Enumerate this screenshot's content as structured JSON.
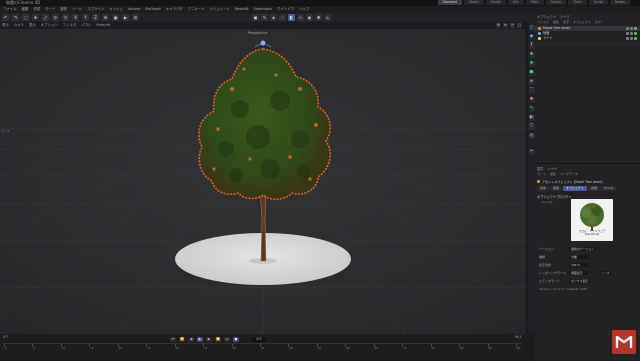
{
  "window": {
    "title": "無題のCinema 4D"
  },
  "layout_tabs": [
    {
      "label": "Standard",
      "active": true
    },
    {
      "label": "Model",
      "active": false
    },
    {
      "label": "Sculpt",
      "active": false
    },
    {
      "label": "UVs",
      "active": false
    },
    {
      "label": "Paint",
      "active": false
    },
    {
      "label": "Groom",
      "active": false
    },
    {
      "label": "Track",
      "active": false
    },
    {
      "label": "Script",
      "active": false
    },
    {
      "label": "Nodes",
      "active": false
    }
  ],
  "menu": [
    "ファイル",
    "編集",
    "作成",
    "モード",
    "選択",
    "ツール",
    "スプライン",
    "メッシュ",
    "Volume",
    "MoGraph",
    "キャラクタ",
    "アニメート",
    "シミュレート",
    "Redshift",
    "Extensions",
    "ウインドウ",
    "ヘルプ"
  ],
  "toolbar": {
    "left_icons": [
      "undo-icon",
      "redo-icon",
      "live-select-icon",
      "move-icon",
      "scale-icon",
      "rotate-icon",
      "recent-icon",
      "x-axis-icon",
      "y-axis-icon",
      "z-axis-icon",
      "coord-icon",
      "render-view-icon",
      "render-icon",
      "render-settings-icon"
    ],
    "center_icons": [
      {
        "name": "cube-icon",
        "active": false
      },
      {
        "name": "pen-icon",
        "active": false
      },
      {
        "name": "subdivide-icon",
        "active": false
      },
      {
        "name": "array-icon",
        "active": false
      },
      {
        "name": "boole-icon",
        "active": true
      },
      {
        "name": "spline-icon",
        "active": false
      },
      {
        "name": "camera-icon",
        "active": false
      },
      {
        "name": "light-icon",
        "active": false
      },
      {
        "name": "scene-icon",
        "active": false
      }
    ]
  },
  "viewport": {
    "menu": [
      "表示",
      "カメラ",
      "表示",
      "オプション",
      "フィルタ",
      "パネル",
      "Redshift"
    ],
    "camera_label": "Perspective",
    "side_label": "パース"
  },
  "timeline": {
    "current_frame": "0 F",
    "start_label": "0 F",
    "end_label": "90 F",
    "ticks": [
      "0",
      "5",
      "10",
      "15",
      "20",
      "25",
      "30",
      "35",
      "40",
      "45",
      "50",
      "55",
      "60",
      "65",
      "70",
      "75",
      "80",
      "85",
      "90"
    ]
  },
  "object_manager": {
    "tabs": [
      "オブジェクト",
      "テイク"
    ],
    "menu": [
      "ファイル",
      "編集",
      "表示",
      "オブジェクト",
      "タグ"
    ],
    "items": [
      {
        "name": "Maple Tree Asset",
        "color": "#d98a2b",
        "selected": true
      },
      {
        "name": "地面",
        "color": "#7aa3d1",
        "selected": false
      },
      {
        "name": "ライト",
        "color": "#e0d35a",
        "selected": false
      }
    ]
  },
  "attribute_manager": {
    "tabs": [
      "属性",
      "レイヤ"
    ],
    "menu": [
      "モード",
      "編集",
      "ユーザデータ"
    ],
    "object_label": "アセットオブジェクト [Maple Tree Asset]",
    "subtabs": [
      {
        "label": "基本",
        "active": false
      },
      {
        "label": "座標",
        "active": false
      },
      {
        "label": "オブジェクト",
        "active": true
      },
      {
        "label": "詳細",
        "active": false
      },
      {
        "label": "Phong",
        "active": false
      }
    ],
    "section": "オブジェクトプロパティ",
    "file_label": "ファイル",
    "preview_caption": "フロム・ソフトウェア\nTree Model",
    "rows": [
      {
        "label": "バージョン",
        "value": "最新のバージョン",
        "extra": ""
      },
      {
        "label": "種類",
        "value": "分離",
        "extra": ""
      },
      {
        "label": "表示割合",
        "value": "100 %",
        "extra": ""
      },
      {
        "label": "レンダリングモード",
        "value": "両面表示",
        "extra": "レンダ"
      },
      {
        "label": "エディタモード",
        "value": "ボックス表示",
        "extra": ""
      }
    ],
    "note": "Version: 1 (1 of 1) / Asset ID: 2023"
  }
}
